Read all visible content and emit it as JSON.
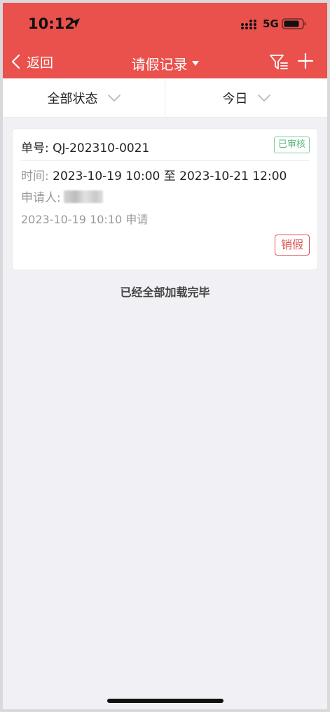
{
  "status_bar": {
    "time": "10:12",
    "network": "5G"
  },
  "nav": {
    "back_label": "返回",
    "title": "请假记录"
  },
  "filters": {
    "status_label": "全部状态",
    "date_label": "今日"
  },
  "record": {
    "order_label": "单号:",
    "order_no": "QJ-202310-0021",
    "status": "已审核",
    "time_label": "时间:",
    "time_range": "2023-10-19 10:00 至 2023-10-21 12:00",
    "applicant_label": "申请人:",
    "applied_at": "2023-10-19 10:10 申请",
    "cancel_label": "销假"
  },
  "list_footer": "已经全部加载完毕",
  "colors": {
    "brand": "#ea514c",
    "approved": "#5ab77a",
    "cancel": "#d9534f"
  }
}
